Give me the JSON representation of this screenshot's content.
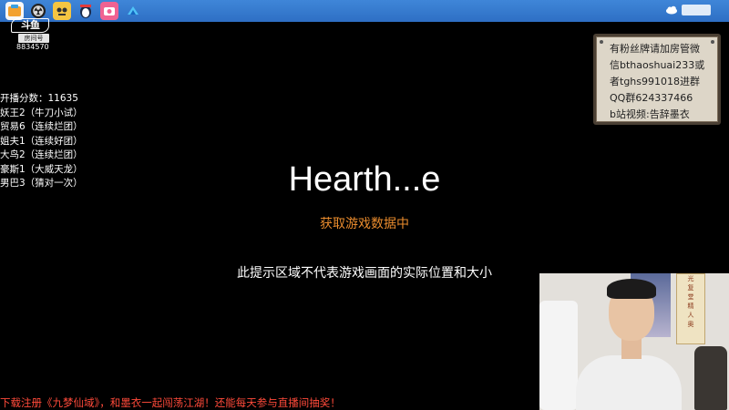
{
  "taskbar": {
    "icons": [
      "douyu-app-icon",
      "obs-icon",
      "chat-app-icon",
      "penguin-app-icon",
      "camera-app-icon",
      "speedometer-app-icon"
    ],
    "tray_icon": "cloud-icon",
    "accent": "#3f86d8"
  },
  "logo": {
    "mark": "斗鱼",
    "room_label": "房间号",
    "room_number": "8834570"
  },
  "stats": {
    "lines": [
      "开播分数：11635",
      "妖王2（牛刀小试）",
      "贸易6（连续烂团）",
      "姐夫1（连续好团）",
      "大鸟2（连续烂团）",
      "豪斯1（大威天龙）",
      "男巴3（猜对一次）"
    ]
  },
  "board": {
    "lines": [
      "有粉丝牌请加房管微",
      "信bthaoshuai233或",
      "者tghs991018进群",
      "QQ群624337466",
      "b站视频:告辞墨衣"
    ]
  },
  "center": {
    "title": "Hearth...e",
    "loading": "获取游戏数据中",
    "notice": "此提示区域不代表游戏画面的实际位置和大小",
    "loading_color": "#e98b2d"
  },
  "webcam": {
    "scroll_chars": [
      "光",
      "复",
      "堂",
      "精",
      "人",
      "奥"
    ]
  },
  "ticker": {
    "text": "下载注册《九梦仙域》，和墨衣一起闯荡江湖！还能每天参与直播间抽奖！",
    "color": "#ff4a3a"
  }
}
